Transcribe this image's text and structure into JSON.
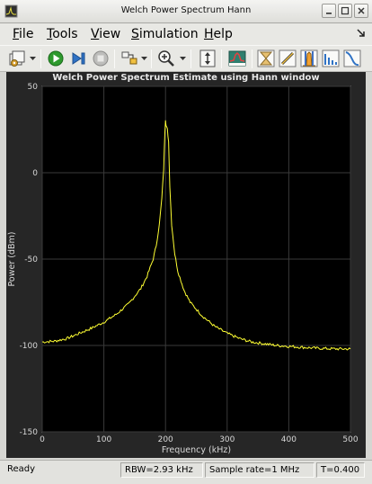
{
  "window": {
    "title": "Welch Power Spectrum Hann"
  },
  "menu": {
    "file": {
      "mnemonic": "F",
      "rest": "ile"
    },
    "tools": {
      "mnemonic": "T",
      "rest": "ools"
    },
    "view": {
      "mnemonic": "V",
      "rest": "iew"
    },
    "simulation": {
      "mnemonic": "S",
      "rest": "imulation"
    },
    "help": {
      "mnemonic": "H",
      "rest": "elp"
    }
  },
  "toolbar": {
    "icons": [
      "settings-icon",
      "run-icon",
      "step-forward-icon",
      "stop-icon",
      "highlight-block-icon",
      "zoom-in-icon",
      "autoscale-icon",
      "spectrum-icon",
      "measure-bandwidth-icon",
      "cursor-measurements-icon",
      "peak-finder-icon",
      "distortion-measurements-icon",
      "ccdf-measurements-icon"
    ],
    "accent_run": "#2e9a2e",
    "accent_play": "#2f72c4"
  },
  "plot": {
    "title": "Welch Power Spectrum Estimate using Hann window",
    "background": "#000000",
    "frame": "#262626",
    "trace_color": "#ffff33"
  },
  "chart_data": {
    "type": "line",
    "title": "Welch Power Spectrum Estimate using Hann window",
    "xlabel": "Frequency (kHz)",
    "ylabel": "Power (dBm)",
    "xlim": [
      0,
      500
    ],
    "ylim": [
      -150,
      50
    ],
    "xticks": [
      "0",
      "100",
      "200",
      "300",
      "400",
      "500"
    ],
    "yticks": [
      "50",
      "0",
      "-50",
      "-100",
      "-150"
    ],
    "grid": true,
    "series": [
      {
        "x": [
          0,
          20,
          40,
          60,
          80,
          100,
          120,
          140,
          160,
          170,
          180,
          185,
          190,
          194,
          197,
          199,
          200,
          201,
          203,
          205,
          207,
          210,
          215,
          220,
          230,
          240,
          260,
          280,
          300,
          320,
          340,
          360,
          380,
          400,
          420,
          440,
          460,
          480,
          500
        ],
        "y": [
          -98,
          -97.5,
          -96,
          -93,
          -90,
          -86.5,
          -82,
          -76,
          -67,
          -60,
          -50,
          -42,
          -30,
          -15,
          2,
          24,
          31,
          27,
          25,
          18,
          -8,
          -30,
          -47,
          -57,
          -68,
          -75,
          -83,
          -89,
          -93,
          -96,
          -98,
          -99,
          -100,
          -100.5,
          -101,
          -101.5,
          -101.8,
          -102,
          -102
        ]
      }
    ]
  },
  "status": {
    "ready": "Ready",
    "rbw": "RBW=2.93 kHz",
    "sample_rate": "Sample rate=1 MHz",
    "time": "T=0.400"
  }
}
